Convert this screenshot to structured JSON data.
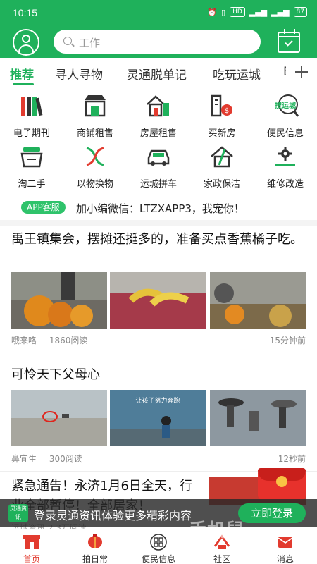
{
  "status": {
    "time": "10:15",
    "battery": "87"
  },
  "search": {
    "placeholder": "工作"
  },
  "tabs": [
    {
      "label": "推荐"
    },
    {
      "label": "寻人寻物"
    },
    {
      "label": "灵通脱单记"
    },
    {
      "label": "吃玩运城"
    },
    {
      "label": "B"
    }
  ],
  "grid": [
    {
      "label": "电子期刊",
      "icon": "books-icon"
    },
    {
      "label": "商铺租售",
      "icon": "shop-icon"
    },
    {
      "label": "房屋租售",
      "icon": "house-icon"
    },
    {
      "label": "买新房",
      "icon": "new-house-icon"
    },
    {
      "label": "便民信息",
      "icon": "search-city-icon",
      "icon_text": "搜运城"
    },
    {
      "label": "淘二手",
      "icon": "basket-icon"
    },
    {
      "label": "以物换物",
      "icon": "exchange-icon"
    },
    {
      "label": "运城拼车",
      "icon": "car-icon"
    },
    {
      "label": "家政保洁",
      "icon": "cleaning-icon"
    },
    {
      "label": "维修改造",
      "icon": "repair-icon"
    }
  ],
  "notice": {
    "badge": "APP客服",
    "text": "加小编微信：LTZXAPP3，我宠你！"
  },
  "articles": [
    {
      "title": "禹王镇集会，摆摊还挺多的，准备买点香蕉橘子吃。",
      "author": "哦来咯",
      "reads": "1860阅读",
      "time": "15分钟前"
    },
    {
      "title": "可怜天下父母心",
      "author": "鼻宜生",
      "reads": "300阅读",
      "time": "12秒前",
      "image_caption": "让孩子努力奔跑"
    },
    {
      "title": "紧急通告！永济1月6日全天，行业全部暂停！全部居家！"
    }
  ],
  "below_meta": "运城资讯 2.3万阅读",
  "login": {
    "logo_text": "灵通资讯",
    "message": "登录灵通资讯体验更多精彩内容",
    "button": "立即登录"
  },
  "nav": [
    {
      "label": "首页",
      "active": true
    },
    {
      "label": "拍日常"
    },
    {
      "label": "便民信息"
    },
    {
      "label": "社区"
    },
    {
      "label": "消息"
    }
  ],
  "watermark": "手机鼠",
  "colors": {
    "brand_green": "#1fb15b",
    "accent_red": "#e23b2f"
  }
}
